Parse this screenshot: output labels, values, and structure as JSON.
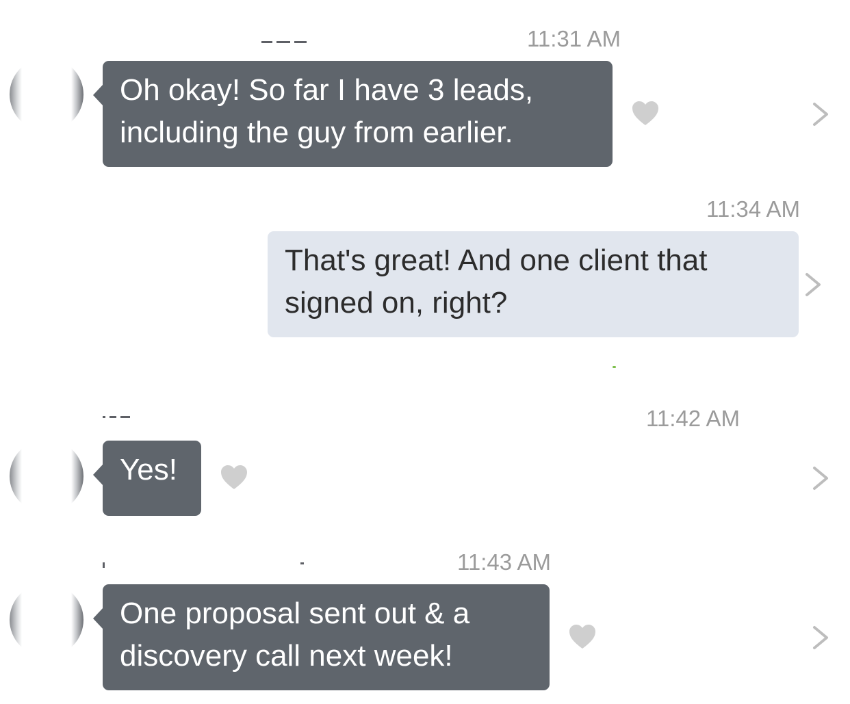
{
  "messages": [
    {
      "direction": "incoming",
      "time": "11:31 AM",
      "text_line1": "Oh okay! So far I have 3 leads,",
      "text_line2": "including the guy from earlier.",
      "liked": true
    },
    {
      "direction": "outgoing",
      "time": "11:34 AM",
      "text_line1": "That's great! And one client that",
      "text_line2": "signed on, right?",
      "liked": false
    },
    {
      "direction": "incoming",
      "time": "11:42 AM",
      "text_line1": "Yes!",
      "liked": true
    },
    {
      "direction": "incoming",
      "time": "11:43 AM",
      "text_line1": "One proposal sent out & a",
      "text_line2": "discovery call next week!",
      "liked": true
    }
  ],
  "icons": {
    "like": "heart-icon",
    "details": "chevron-right-icon",
    "avatar": "contact-avatar"
  },
  "colors": {
    "incoming_bubble": "#5f656c",
    "outgoing_bubble": "#e1e6ee",
    "timestamp": "#9b9b9b",
    "icon_gray": "#cfcfcf"
  }
}
